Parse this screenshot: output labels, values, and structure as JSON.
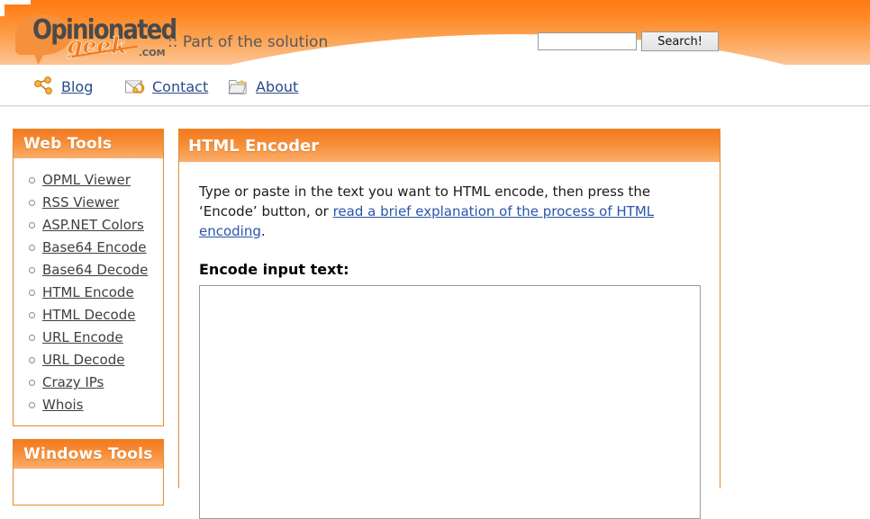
{
  "site": {
    "logo_word": "Opinionated",
    "logo_script": "geek",
    "logo_tld": ".COM",
    "tagline": ":: Part of the solution"
  },
  "search": {
    "value": "",
    "placeholder": "",
    "button_label": "Search!"
  },
  "nav": {
    "items": [
      {
        "label": "Blog",
        "icon": "share-network-icon"
      },
      {
        "label": "Contact",
        "icon": "envelope-icon"
      },
      {
        "label": "About",
        "icon": "folder-stars-icon"
      }
    ]
  },
  "sidebar": {
    "panels": [
      {
        "title": "Web Tools",
        "items": [
          "OPML Viewer",
          "RSS Viewer",
          "ASP.NET Colors",
          "Base64 Encode",
          "Base64 Decode",
          "HTML Encode",
          "HTML Decode",
          "URL Encode",
          "URL Decode",
          "Crazy IPs",
          "Whois"
        ]
      },
      {
        "title": "Windows Tools",
        "items": []
      }
    ]
  },
  "main": {
    "title": "HTML Encoder",
    "intro_before": "Type or paste in the text you want to HTML encode, then press the ‘Encode’ button, or ",
    "intro_link": "read a brief explanation of the process of HTML encoding",
    "intro_after": ".",
    "field_label": "Encode input text:",
    "input_value": "",
    "input_placeholder": ""
  },
  "colors": {
    "brand_orange": "#F47A20",
    "brand_orange_light": "#FBAE6A",
    "panel_border": "#E58A2E",
    "link_blue": "#2A55A8",
    "nav_link_blue": "#2A4A8B"
  }
}
